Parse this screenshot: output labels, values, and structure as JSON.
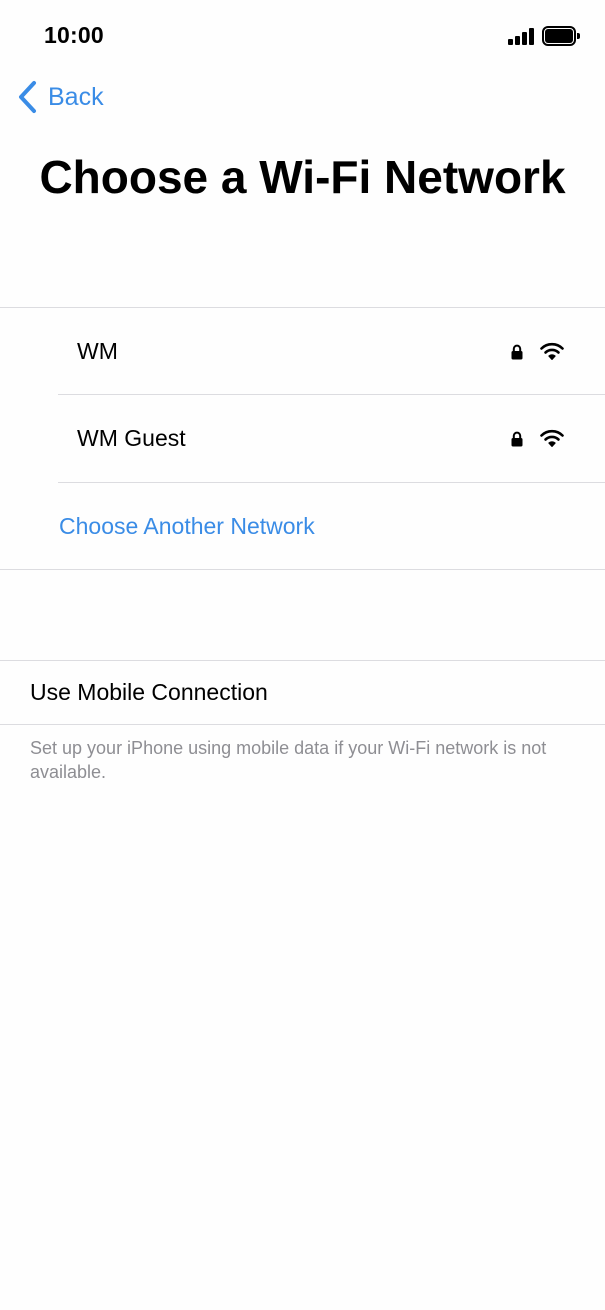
{
  "status_bar": {
    "time": "10:00",
    "icons": [
      "cellular-signal-icon",
      "battery-icon"
    ]
  },
  "nav": {
    "back_label": "Back",
    "back_icon": "chevron-left-icon"
  },
  "title": "Choose a Wi-Fi Network",
  "networks": [
    {
      "name": "WM",
      "secured": true,
      "icons": [
        "lock-icon",
        "wifi-icon"
      ]
    },
    {
      "name": "WM Guest",
      "secured": true,
      "icons": [
        "lock-icon",
        "wifi-icon"
      ]
    }
  ],
  "choose_another_label": "Choose Another Network",
  "mobile": {
    "label": "Use Mobile Connection",
    "note": "Set up your iPhone using mobile data if your Wi-Fi network is not available."
  },
  "colors": {
    "accent": "#3a8ce6",
    "separator": "#dcdce0",
    "secondary_text": "#8e8e93",
    "background": "#fefefe"
  }
}
